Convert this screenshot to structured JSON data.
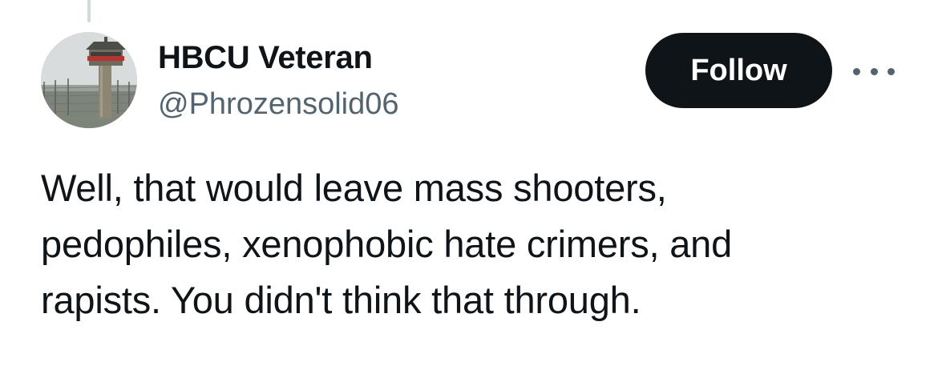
{
  "tweet": {
    "author": {
      "display_name": "HBCU Veteran",
      "handle": "@Phrozensolid06",
      "avatar_icon": "guard-tower-avatar"
    },
    "follow_label": "Follow",
    "more_icon": "more-options-icon",
    "text_lines": [
      "Well, that would leave mass shooters,",
      "pedophiles, xenophobic hate crimers, and",
      "rapists. You didn't think that through."
    ]
  },
  "colors": {
    "text_primary": "#0f1419",
    "text_secondary": "#536471",
    "button_bg": "#0f1419",
    "button_text": "#ffffff",
    "thread_line": "#cfd9de"
  }
}
